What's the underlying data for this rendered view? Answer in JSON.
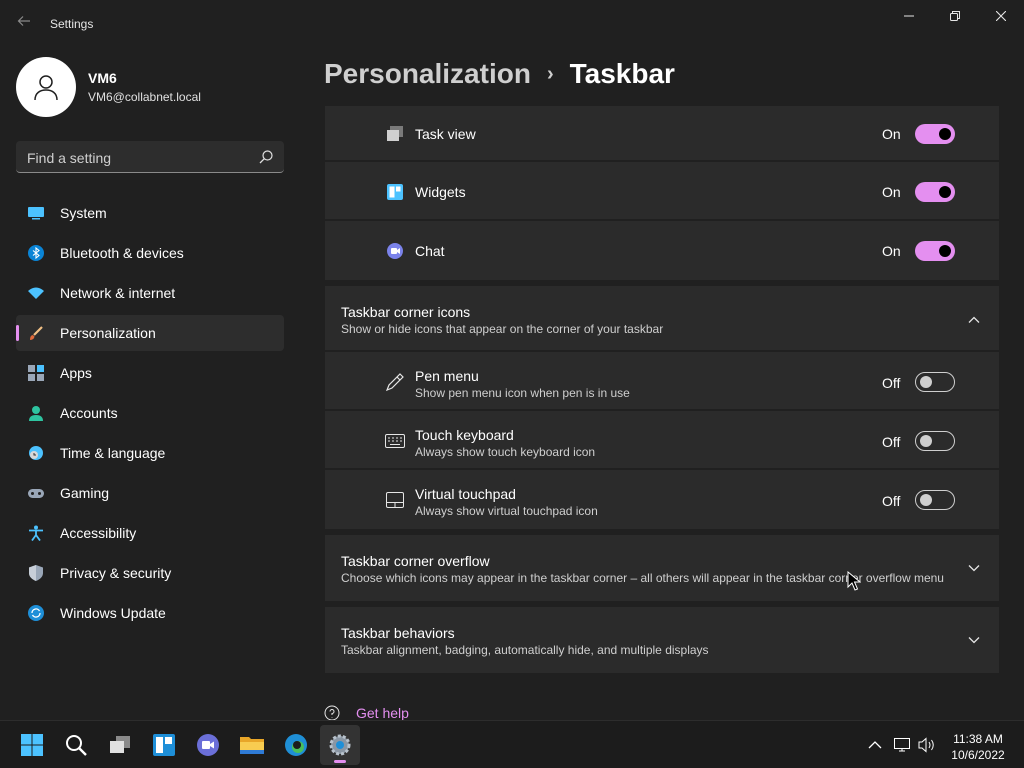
{
  "app": {
    "title": "Settings"
  },
  "user": {
    "name": "VM6",
    "email": "VM6@collabnet.local"
  },
  "search": {
    "placeholder": "Find a setting"
  },
  "nav": [
    {
      "label": "System",
      "icon": "monitor-icon"
    },
    {
      "label": "Bluetooth & devices",
      "icon": "bluetooth-icon"
    },
    {
      "label": "Network & internet",
      "icon": "wifi-icon"
    },
    {
      "label": "Personalization",
      "icon": "brush-icon",
      "active": true
    },
    {
      "label": "Apps",
      "icon": "apps-icon"
    },
    {
      "label": "Accounts",
      "icon": "person-icon"
    },
    {
      "label": "Time & language",
      "icon": "clock-globe-icon"
    },
    {
      "label": "Gaming",
      "icon": "gamepad-icon"
    },
    {
      "label": "Accessibility",
      "icon": "accessibility-icon"
    },
    {
      "label": "Privacy & security",
      "icon": "shield-icon"
    },
    {
      "label": "Windows Update",
      "icon": "update-icon"
    }
  ],
  "breadcrumb": {
    "parent": "Personalization",
    "separator": "›",
    "current": "Taskbar"
  },
  "taskbar_items": [
    {
      "label": "Task view",
      "state": "On",
      "on": true,
      "icon": "task-view-icon"
    },
    {
      "label": "Widgets",
      "state": "On",
      "on": true,
      "icon": "widgets-icon"
    },
    {
      "label": "Chat",
      "state": "On",
      "on": true,
      "icon": "chat-icon"
    }
  ],
  "corner_icons": {
    "title": "Taskbar corner icons",
    "subtitle": "Show or hide icons that appear on the corner of your taskbar",
    "expanded": true,
    "items": [
      {
        "label": "Pen menu",
        "subtitle": "Show pen menu icon when pen is in use",
        "state": "Off",
        "on": false,
        "icon": "pen-icon"
      },
      {
        "label": "Touch keyboard",
        "subtitle": "Always show touch keyboard icon",
        "state": "Off",
        "on": false,
        "icon": "keyboard-icon"
      },
      {
        "label": "Virtual touchpad",
        "subtitle": "Always show virtual touchpad icon",
        "state": "Off",
        "on": false,
        "icon": "touchpad-icon"
      }
    ]
  },
  "corner_overflow": {
    "title": "Taskbar corner overflow",
    "subtitle": "Choose which icons may appear in the taskbar corner – all others will appear in the taskbar corner overflow menu"
  },
  "behaviors": {
    "title": "Taskbar behaviors",
    "subtitle": "Taskbar alignment, badging, automatically hide, and multiple displays"
  },
  "help": {
    "label": "Get help"
  },
  "clock": {
    "time": "11:38 AM",
    "date": "10/6/2022"
  },
  "colors": {
    "accent": "#e48ff0",
    "background": "#202020",
    "card": "#2b2b2b"
  }
}
